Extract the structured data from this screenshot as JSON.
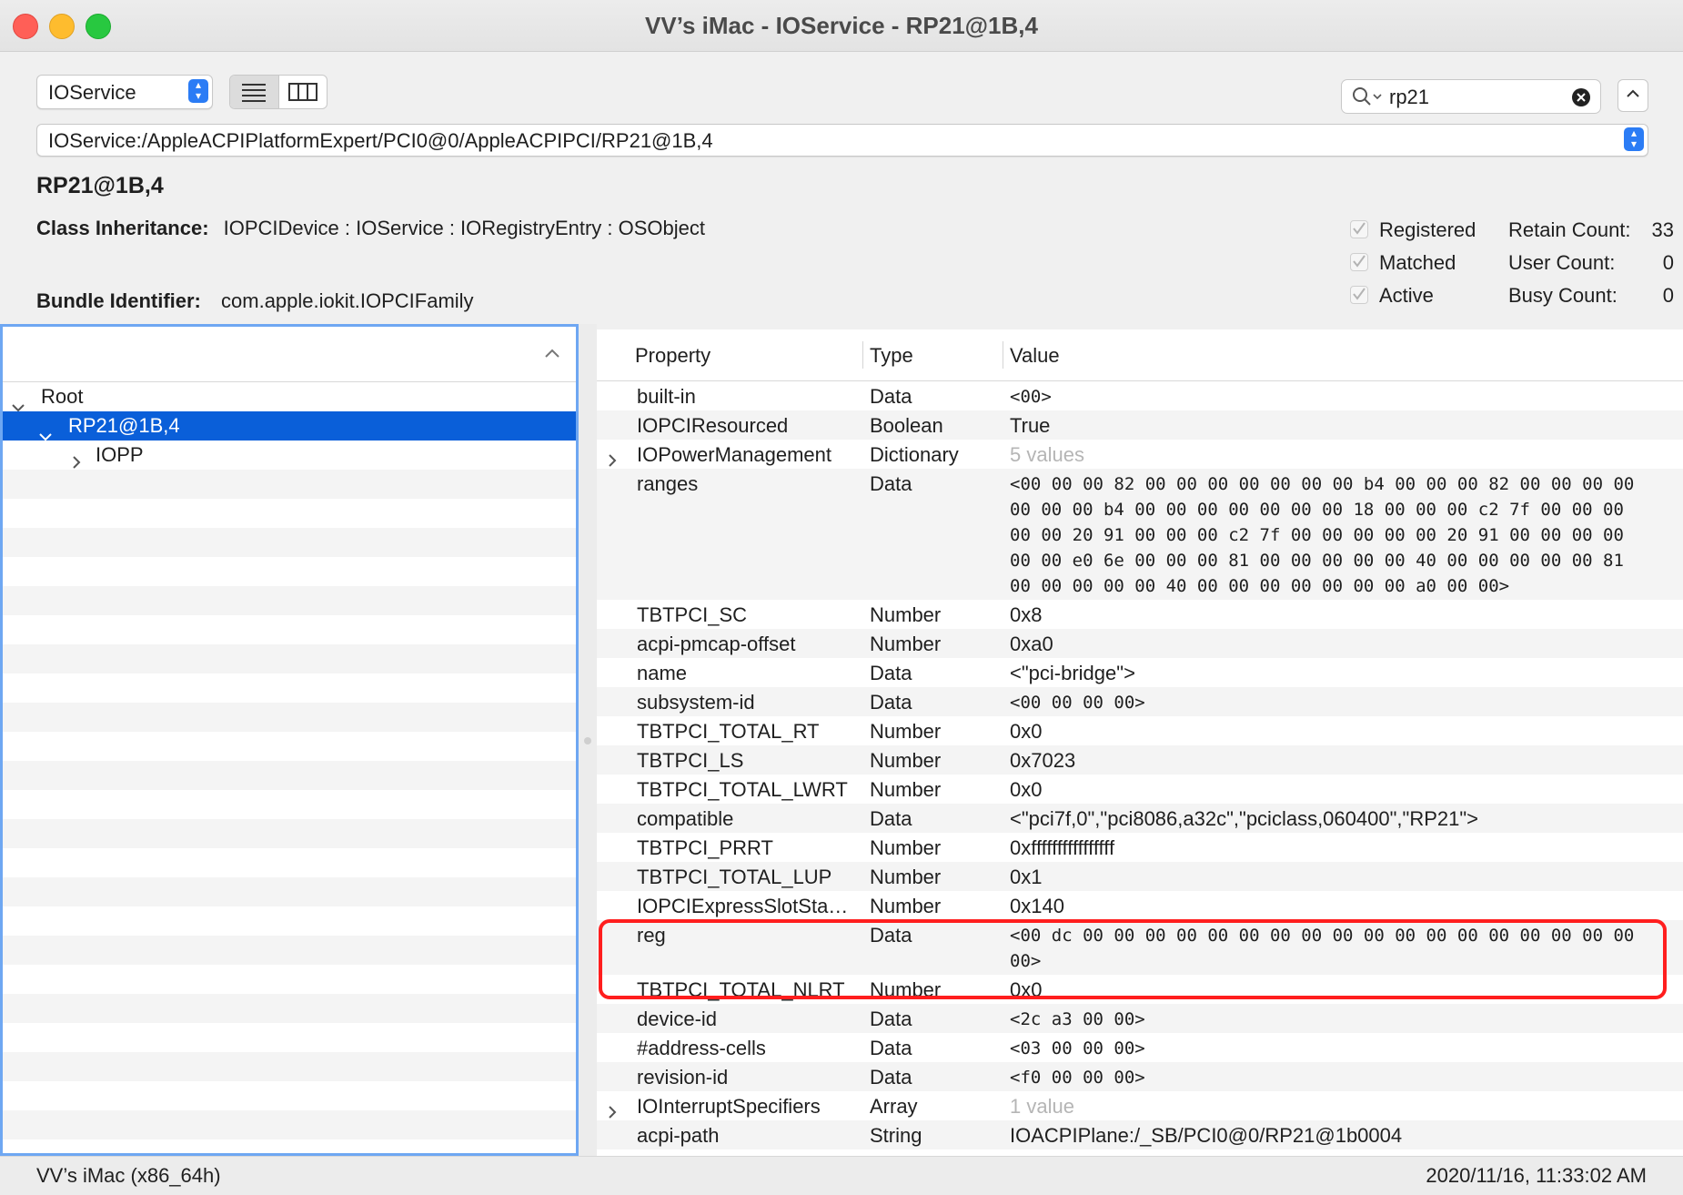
{
  "window": {
    "title": "VV’s iMac - IOService - RP21@1B,4"
  },
  "toolbar": {
    "plane": "IOService",
    "search": "rp21",
    "path": "IOService:/AppleACPIPlatformExpert/PCI0@0/AppleACPIPCI/RP21@1B,4"
  },
  "entry": {
    "name": "RP21@1B,4",
    "class_label": "Class Inheritance:",
    "class_value": "IOPCIDevice : IOService : IORegistryEntry : OSObject",
    "bundle_label": "Bundle Identifier:",
    "bundle_value": "com.apple.iokit.IOPCIFamily",
    "flags": [
      {
        "label": "Registered",
        "checked": true
      },
      {
        "label": "Matched",
        "checked": true
      },
      {
        "label": "Active",
        "checked": true
      }
    ],
    "counts": [
      {
        "label": "Retain Count:",
        "value": "33"
      },
      {
        "label": "User Count:",
        "value": "0"
      },
      {
        "label": "Busy Count:",
        "value": "0"
      }
    ]
  },
  "tree": {
    "rows": [
      {
        "label": "Root",
        "disclosure": "expanded",
        "indent": 0
      },
      {
        "label": "RP21@1B,4",
        "disclosure": "expanded",
        "indent": 1,
        "selected": true
      },
      {
        "label": "IOPP",
        "disclosure": "collapsed",
        "indent": 2
      }
    ]
  },
  "properties": {
    "headers": {
      "property": "Property",
      "type": "Type",
      "value": "Value"
    },
    "rows": [
      {
        "property": "built-in",
        "type": "Data",
        "value": [
          "<00>"
        ],
        "mono": true
      },
      {
        "property": "IOPCIResourced",
        "type": "Boolean",
        "value": [
          "True"
        ]
      },
      {
        "property": "IOPowerManagement",
        "type": "Dictionary",
        "value": [
          "5 values"
        ],
        "dim": true,
        "expandable": true
      },
      {
        "property": "ranges",
        "type": "Data",
        "mono": true,
        "value": [
          "<00 00 00 82 00 00 00 00 00 00 00 b4 00 00 00 82 00 00 00 00",
          "00 00 00 b4 00 00 00 00 00 00 00 18 00 00 00 c2 7f 00 00 00",
          "00 00 20 91 00 00 00 c2 7f 00 00 00 00 00 20 91 00 00 00 00",
          "00 00 e0 6e 00 00 00 81 00 00 00 00 00 40 00 00 00 00 00 81",
          "00 00 00 00 00 40 00 00 00 00 00 00 00 a0 00 00>"
        ]
      },
      {
        "property": "TBTPCI_SC",
        "type": "Number",
        "value": [
          "0x8"
        ]
      },
      {
        "property": "acpi-pmcap-offset",
        "type": "Number",
        "value": [
          "0xa0"
        ]
      },
      {
        "property": "name",
        "type": "Data",
        "value": [
          "<\"pci-bridge\">"
        ]
      },
      {
        "property": "subsystem-id",
        "type": "Data",
        "mono": true,
        "value": [
          "<00 00 00 00>"
        ]
      },
      {
        "property": "TBTPCI_TOTAL_RT",
        "type": "Number",
        "value": [
          "0x0"
        ]
      },
      {
        "property": "TBTPCI_LS",
        "type": "Number",
        "value": [
          "0x7023"
        ]
      },
      {
        "property": "TBTPCI_TOTAL_LWRT",
        "type": "Number",
        "value": [
          "0x0"
        ]
      },
      {
        "property": "compatible",
        "type": "Data",
        "value": [
          "<\"pci7f,0\",\"pci8086,a32c\",\"pciclass,060400\",\"RP21\">"
        ]
      },
      {
        "property": "TBTPCI_PRRT",
        "type": "Number",
        "value": [
          "0xffffffffffffffff"
        ]
      },
      {
        "property": "TBTPCI_TOTAL_LUP",
        "type": "Number",
        "value": [
          "0x1"
        ]
      },
      {
        "property": "IOPCIExpressSlotSta…",
        "type": "Number",
        "value": [
          "0x140"
        ]
      },
      {
        "property": "reg",
        "type": "Data",
        "mono": true,
        "value": [
          "<00 dc 00 00 00 00 00 00 00 00 00 00 00 00 00 00 00 00 00 00",
          "00>"
        ]
      },
      {
        "property": "TBTPCI_TOTAL_NLRT",
        "type": "Number",
        "value": [
          "0x0"
        ]
      },
      {
        "property": "device-id",
        "type": "Data",
        "mono": true,
        "value": [
          "<2c a3 00 00>"
        ]
      },
      {
        "property": "#address-cells",
        "type": "Data",
        "mono": true,
        "value": [
          "<03 00 00 00>"
        ]
      },
      {
        "property": "revision-id",
        "type": "Data",
        "mono": true,
        "value": [
          "<f0 00 00 00>"
        ]
      },
      {
        "property": "IOInterruptSpecifiers",
        "type": "Array",
        "value": [
          "1 value"
        ],
        "dim": true,
        "expandable": true
      },
      {
        "property": "acpi-path",
        "type": "String",
        "value": [
          "IOACPIPlane:/_SB/PCI0@0/RP21@1b0004"
        ]
      }
    ]
  },
  "status": {
    "machine": "VV’s iMac (x86_64h)",
    "timestamp": "2020/11/16, 11:33:02 AM"
  },
  "colors": {
    "selection": "#0a5fd9",
    "accent": "#2b7cf5",
    "highlight": "#ff1e1e"
  }
}
